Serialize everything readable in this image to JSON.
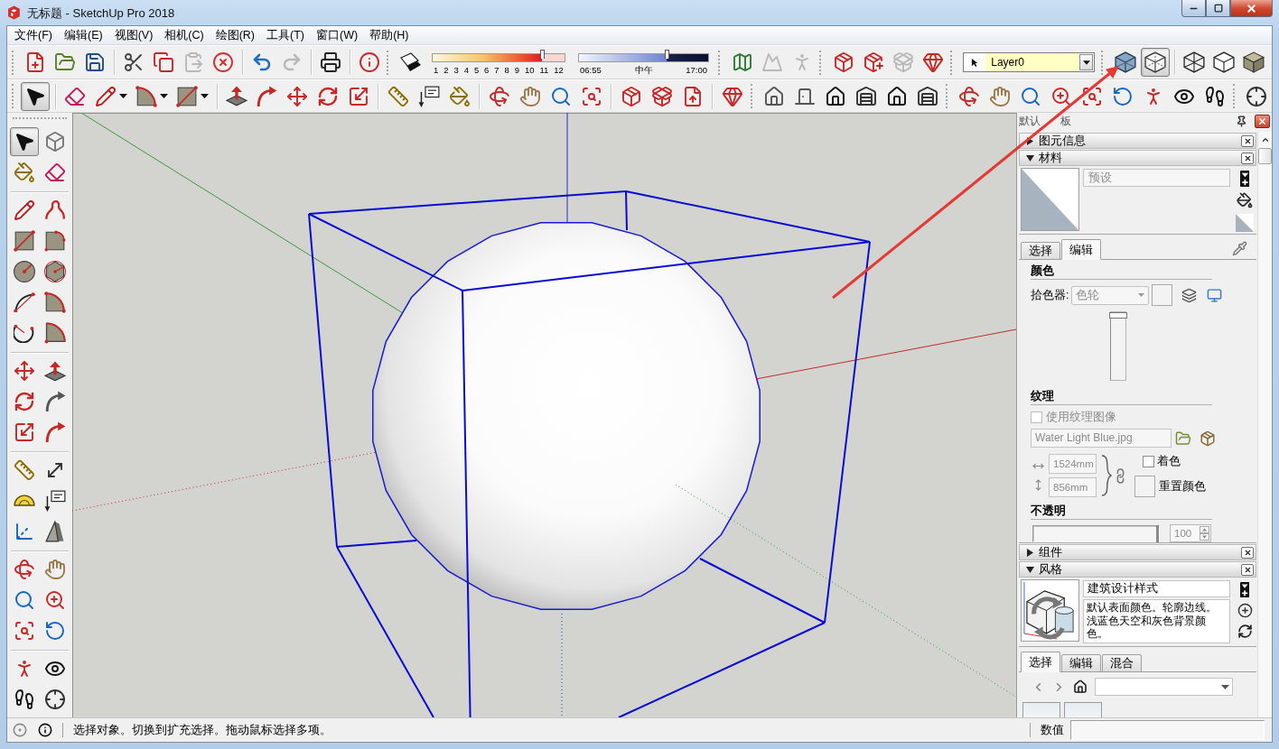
{
  "window": {
    "title": "无标题 - SketchUp Pro 2018"
  },
  "menu": [
    "文件(F)",
    "编辑(E)",
    "视图(V)",
    "相机(C)",
    "绘图(R)",
    "工具(T)",
    "窗口(W)",
    "帮助(H)"
  ],
  "standard_toolbar": [
    [
      {
        "disabled": false
      },
      {
        "disabled": false
      },
      {
        "disabled": false
      }
    ],
    [
      {
        "disabled": false
      },
      {
        "disabled": false
      },
      {
        "disabled": true
      },
      {
        "disabled": false
      }
    ],
    [
      {
        "disabled": false
      },
      {
        "disabled": true
      }
    ],
    [
      {
        "disabled": false
      }
    ],
    [
      {
        "disabled": false
      }
    ]
  ],
  "shadow_toolbar": {
    "month_slider": {
      "ticks": [
        "1",
        "2",
        "3",
        "4",
        "5",
        "6",
        "7",
        "8",
        "9",
        "10",
        "11",
        "12"
      ],
      "level": 0.83
    },
    "time_slider": {
      "start": "06:55",
      "middle": "中午",
      "end": "17:00",
      "level": 0.68
    }
  },
  "location_toolbar": [
    {
      "disabled": false
    },
    {
      "disabled": true
    },
    {
      "disabled": true
    }
  ],
  "warehouse_toolbar": [
    {
      "disabled": false
    },
    {
      "disabled": false
    },
    {
      "disabled": true
    },
    {
      "disabled": false
    }
  ],
  "layer_toolbar": {
    "value": "Layer0"
  },
  "style_toolbar": [
    {
      "selected": false
    },
    {
      "selected": true
    },
    {
      "selected": false
    },
    {
      "selected": false
    },
    {
      "selected": false
    }
  ],
  "tool_toolbar": [
    [
      {
        "selected": true
      }
    ],
    [
      {
        "selected": false
      },
      {
        "selected": false
      },
      {
        "selected": false
      },
      {
        "selected": false
      }
    ],
    [
      {
        "selected": false
      },
      {
        "selected": false
      },
      {
        "selected": false
      },
      {
        "selected": false
      },
      {
        "selected": false
      }
    ],
    [
      {
        "selected": false
      },
      {
        "selected": false
      },
      {
        "selected": false
      }
    ],
    [
      {
        "selected": false
      },
      {
        "selected": false
      },
      {
        "selected": false
      },
      {
        "selected": false
      }
    ],
    [
      {
        "selected": false
      },
      {
        "selected": false
      },
      {
        "selected": false
      }
    ],
    [
      {
        "selected": false
      }
    ],
    [
      {
        "selected": false
      },
      {
        "selected": false
      },
      {
        "selected": false
      },
      {
        "selected": false
      },
      {
        "selected": false
      },
      {
        "selected": false
      }
    ],
    [
      {
        "selected": false
      },
      {
        "selected": false
      },
      {
        "selected": false
      },
      {
        "selected": false
      },
      {
        "selected": false
      },
      {
        "selected": false
      },
      {
        "selected": false
      },
      {
        "selected": false
      },
      {
        "selected": false
      }
    ],
    [
      {
        "selected": false
      }
    ]
  ],
  "tool_palette": [
    [
      {
        "selected": true
      },
      {
        "selected": false
      },
      {
        "selected": false
      },
      {
        "selected": false
      }
    ],
    [
      {
        "selected": false
      },
      {
        "selected": false
      },
      {
        "selected": false
      },
      {
        "selected": false
      },
      {
        "selected": false
      },
      {
        "selected": false
      },
      {
        "selected": false
      },
      {
        "selected": false
      },
      {
        "selected": false
      },
      {
        "selected": false
      }
    ],
    [
      {
        "selected": false
      },
      {
        "selected": false
      },
      {
        "selected": false
      },
      {
        "selected": false
      },
      {
        "selected": false
      },
      {
        "selected": false
      }
    ],
    [
      {
        "selected": false
      },
      {
        "selected": false
      },
      {
        "selected": false
      },
      {
        "selected": false
      },
      {
        "selected": false
      },
      {
        "selected": false
      }
    ],
    [
      {
        "selected": false
      },
      {
        "selected": false
      },
      {
        "selected": false
      },
      {
        "selected": false
      },
      {
        "selected": false
      },
      {
        "selected": false
      }
    ],
    [
      {
        "selected": false
      },
      {
        "selected": false
      },
      {
        "selected": false
      },
      {
        "selected": false
      }
    ]
  ],
  "tray": {
    "title_parts": [
      "默认",
      "板"
    ],
    "panels": [
      {
        "kind": "entity_info",
        "title": "图元信息",
        "expanded": false
      },
      {
        "kind": "materials",
        "title": "材料",
        "expanded": true,
        "name_field": {
          "value": "预设",
          "disabled": true
        },
        "tabs": [
          {
            "label": "选择",
            "selected": false
          },
          {
            "label": "编辑",
            "selected": true
          }
        ],
        "color_section": {
          "title": "颜色",
          "picker": {
            "label": "拾色器:",
            "value": "色轮",
            "disabled": true
          },
          "vertical_slider": {
            "level": 1
          }
        },
        "texture_section": {
          "title": "纹理",
          "use_texture": {
            "label": "使用纹理图像",
            "checked": false,
            "disabled": true
          },
          "file_field": {
            "value": "Water Light Blue.jpg",
            "disabled": true
          },
          "width_field": {
            "value": "1524mm",
            "disabled": true
          },
          "height_field": {
            "value": "856mm",
            "disabled": true
          },
          "colorize": {
            "label": "着色",
            "checked": false
          },
          "reset_label": "重置颜色"
        },
        "opacity_section": {
          "title": "不透明",
          "slider": {
            "level": 1
          },
          "value_field": {
            "value": "100",
            "disabled": true
          }
        }
      },
      {
        "kind": "components",
        "title": "组件",
        "expanded": false
      },
      {
        "kind": "styles",
        "title": "风格",
        "expanded": true,
        "style_name": "建筑设计样式",
        "description": "默认表面颜色。轮廓边线。浅蓝色天空和灰色背景颜色。",
        "tabs": [
          {
            "label": "选择",
            "selected": true
          },
          {
            "label": "编辑",
            "selected": false
          },
          {
            "label": "混合",
            "selected": false
          }
        ]
      }
    ]
  },
  "status_bar": {
    "message": "选择对象。切换到扩充选择。拖动鼠标选择多项。",
    "measurement_label": "数值"
  }
}
